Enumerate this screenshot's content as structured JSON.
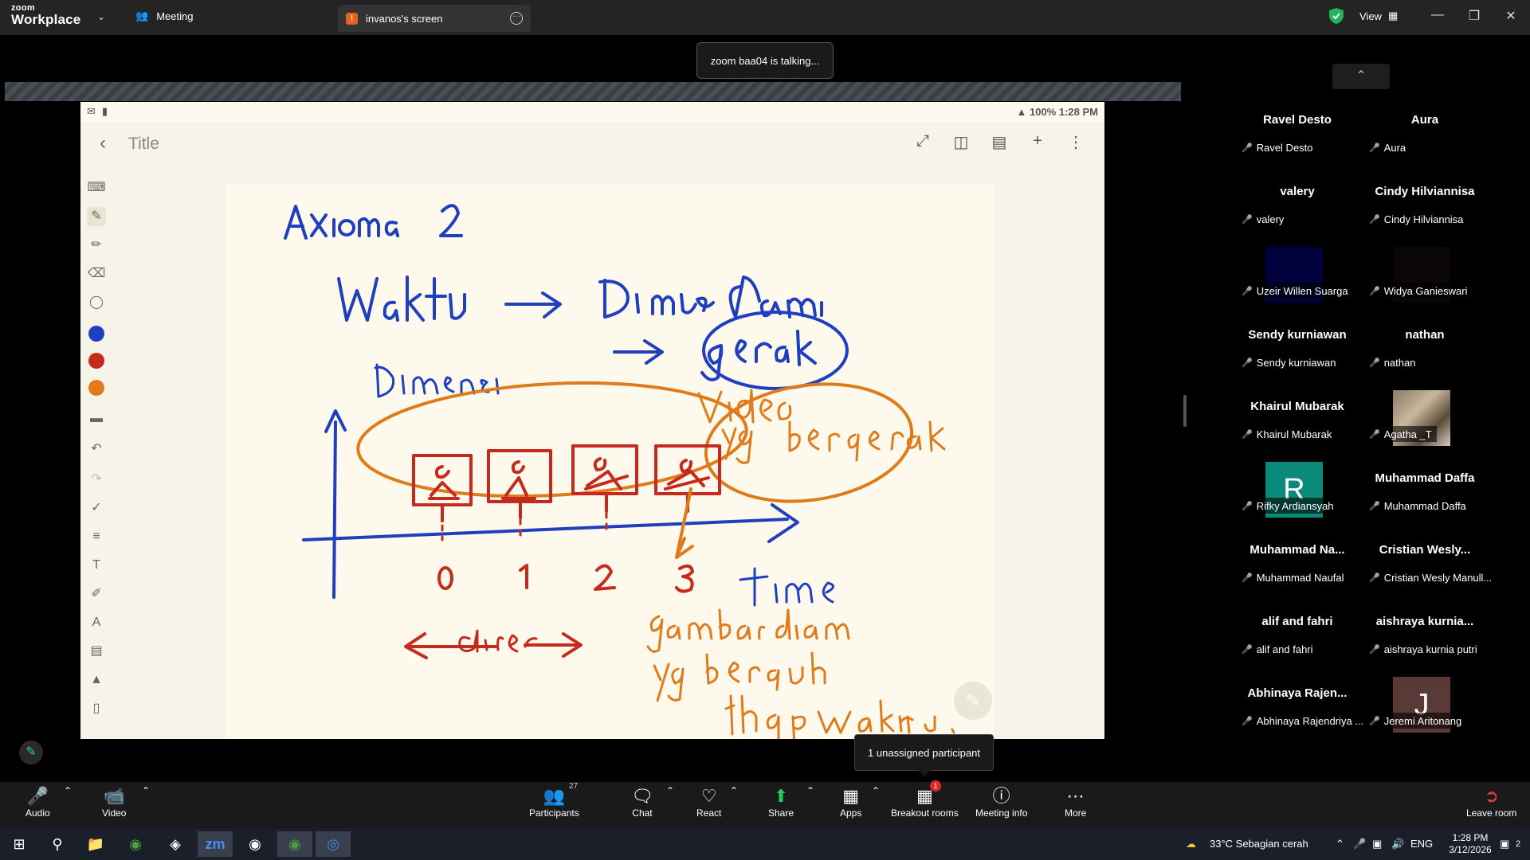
{
  "titlebar": {
    "logo_line1": "zoom",
    "logo_line2": "Workplace",
    "meeting_tab": "Meeting",
    "screen_tab": "invanos's screen",
    "view_label": "View"
  },
  "talking_banner": "zoom baa04 is talking...",
  "phone": {
    "battery": "100%",
    "time": "1:28 PM",
    "note_title": "Title",
    "pen_colors": [
      "#1f3fbf",
      "#c62a1c",
      "#e07b1b"
    ]
  },
  "gallery": [
    {
      "name": "Ravel Desto",
      "label": "Ravel Desto"
    },
    {
      "name": "Aura",
      "label": "Aura"
    },
    {
      "name": "valery",
      "label": "valery"
    },
    {
      "name": "Cindy Hilviannisa",
      "label": "Cindy Hilviannisa"
    },
    {
      "name": "",
      "label": "Uzeir Willen Suarga"
    },
    {
      "name": "",
      "label": "Widya Ganieswari"
    },
    {
      "name": "Sendy kurniawan",
      "label": "Sendy kurniawan"
    },
    {
      "name": "nathan",
      "label": "nathan"
    },
    {
      "name": "Khairul Mubarak",
      "label": "Khairul Mubarak"
    },
    {
      "name": "",
      "label": "Agatha _T"
    },
    {
      "name": "",
      "label": "Rifky Ardiansyah",
      "avatar": "R"
    },
    {
      "name": "Muhammad Daffa",
      "label": "Muhammad Daffa"
    },
    {
      "name": "Muhammad  Na...",
      "label": "Muhammad Naufal"
    },
    {
      "name": "Cristian  Wesly...",
      "label": "Cristian Wesly Manull..."
    },
    {
      "name": "alif and fahri",
      "label": "alif and fahri"
    },
    {
      "name": "aishraya  kurnia...",
      "label": "aishraya kurnia putri"
    },
    {
      "name": "Abhinaya  Rajen...",
      "label": "Abhinaya Rajendriya ..."
    },
    {
      "name": "",
      "label": "Jeremi Aritonang",
      "avatar": "J"
    }
  ],
  "tooltip": "1 unassigned participant",
  "toolbar": {
    "audio": "Audio",
    "video": "Video",
    "participants": "Participants",
    "participants_count": "27",
    "chat": "Chat",
    "react": "React",
    "share": "Share",
    "apps": "Apps",
    "breakout": "Breakout rooms",
    "breakout_badge": "1",
    "meeting_info": "Meeting info",
    "more": "More",
    "leave": "Leave room"
  },
  "taskbar": {
    "weather": "33°C  Sebagian cerah",
    "lang": "ENG",
    "time": "1:28 PM",
    "date": "3/12/2026",
    "notif_count": "2"
  }
}
